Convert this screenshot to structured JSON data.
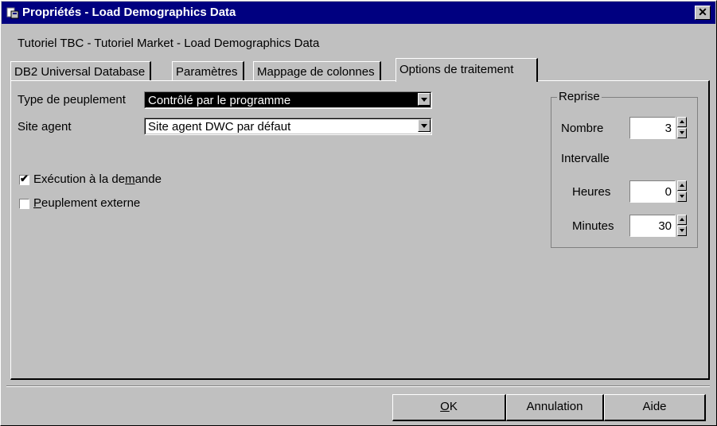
{
  "window": {
    "title": "Propriétés - Load Demographics Data",
    "close_glyph": "✕"
  },
  "subtitle": "Tutoriel TBC - Tutoriel Market - Load Demographics Data",
  "tabs": [
    {
      "label": "DB2 Universal Database",
      "active": false
    },
    {
      "label": "Paramètres",
      "active": false
    },
    {
      "label": "Mappage de colonnes",
      "active": false
    },
    {
      "label": "Options de traitement",
      "active": true
    }
  ],
  "form": {
    "population_type": {
      "label": "Type de peuplement",
      "value": "Contrôlé par le programme"
    },
    "agent_site": {
      "label": "Site agent",
      "value": "Site agent DWC par défaut"
    },
    "on_demand": {
      "label_pre": "Exécution à la de",
      "label_mnemonic": "m",
      "label_post": "ande",
      "checked": true
    },
    "external_population": {
      "label_mnemonic": "P",
      "label_post": "euplement externe",
      "checked": false
    }
  },
  "retry": {
    "title": "Reprise",
    "count_label": "Nombre",
    "count_value": "3",
    "interval_label": "Intervalle",
    "hours_label": "Heures",
    "hours_value": "0",
    "minutes_label": "Minutes",
    "minutes_value": "30"
  },
  "buttons": {
    "ok_mnemonic": "O",
    "ok_post": "K",
    "cancel": "Annulation",
    "help": "Aide"
  },
  "colors": {
    "titlebar": "#000080",
    "dialog": "#c0c0c0",
    "selection": "#000000"
  }
}
